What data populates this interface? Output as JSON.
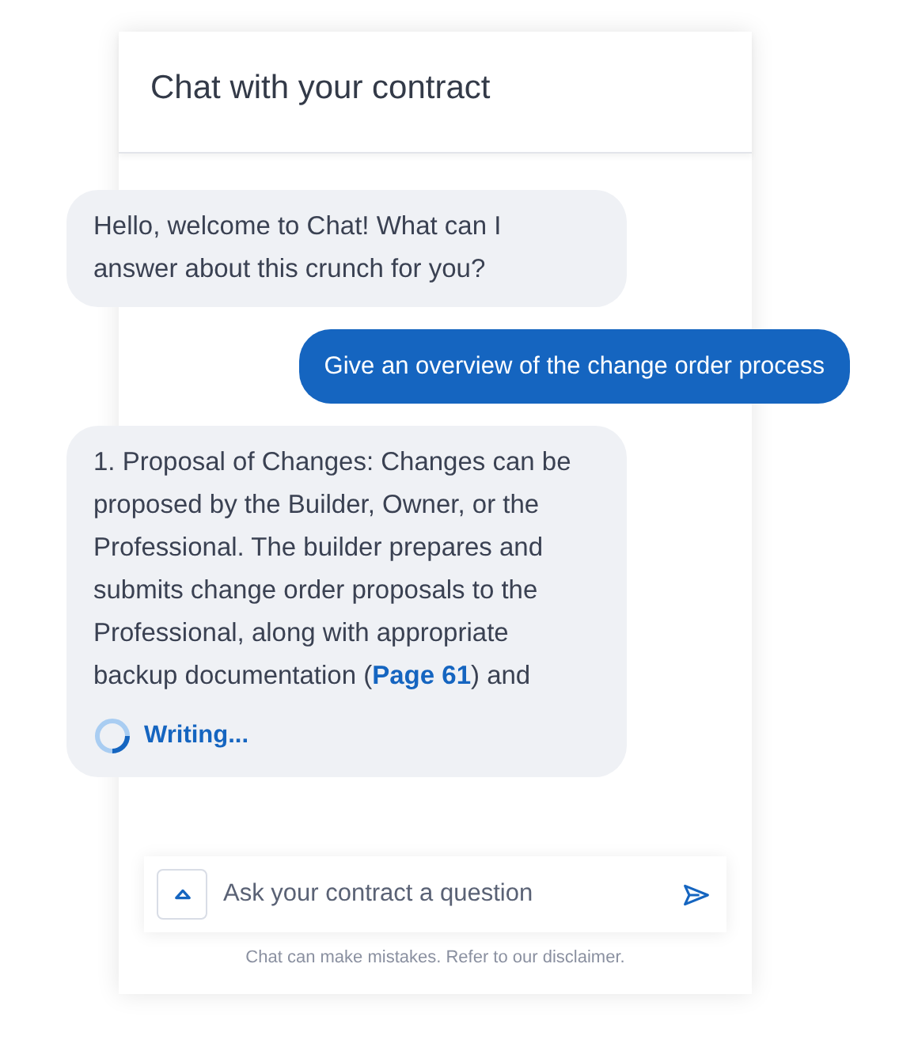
{
  "header": {
    "title": "Chat with your contract"
  },
  "messages": [
    {
      "kind": "bot",
      "parts": [
        {
          "kind": "text",
          "text": "Hello, welcome to Chat! What can I answer about this crunch for you?"
        }
      ]
    },
    {
      "kind": "user",
      "parts": [
        {
          "kind": "text",
          "text": "Give an overview of the change order process"
        }
      ]
    },
    {
      "kind": "bot",
      "parts": [
        {
          "kind": "text",
          "text": "1. Proposal of Changes: Changes can be proposed by the Builder, Owner, or the Professional. The builder prepares and submits change order proposals to the Professional, along with appropriate backup documentation ("
        },
        {
          "kind": "link",
          "text": "Page 61"
        },
        {
          "kind": "text",
          "text": ") and"
        }
      ],
      "status": "Writing..."
    }
  ],
  "composer": {
    "placeholder": "Ask your contract a question"
  },
  "disclaimer": "Chat can make mistakes. Refer to our disclaimer."
}
